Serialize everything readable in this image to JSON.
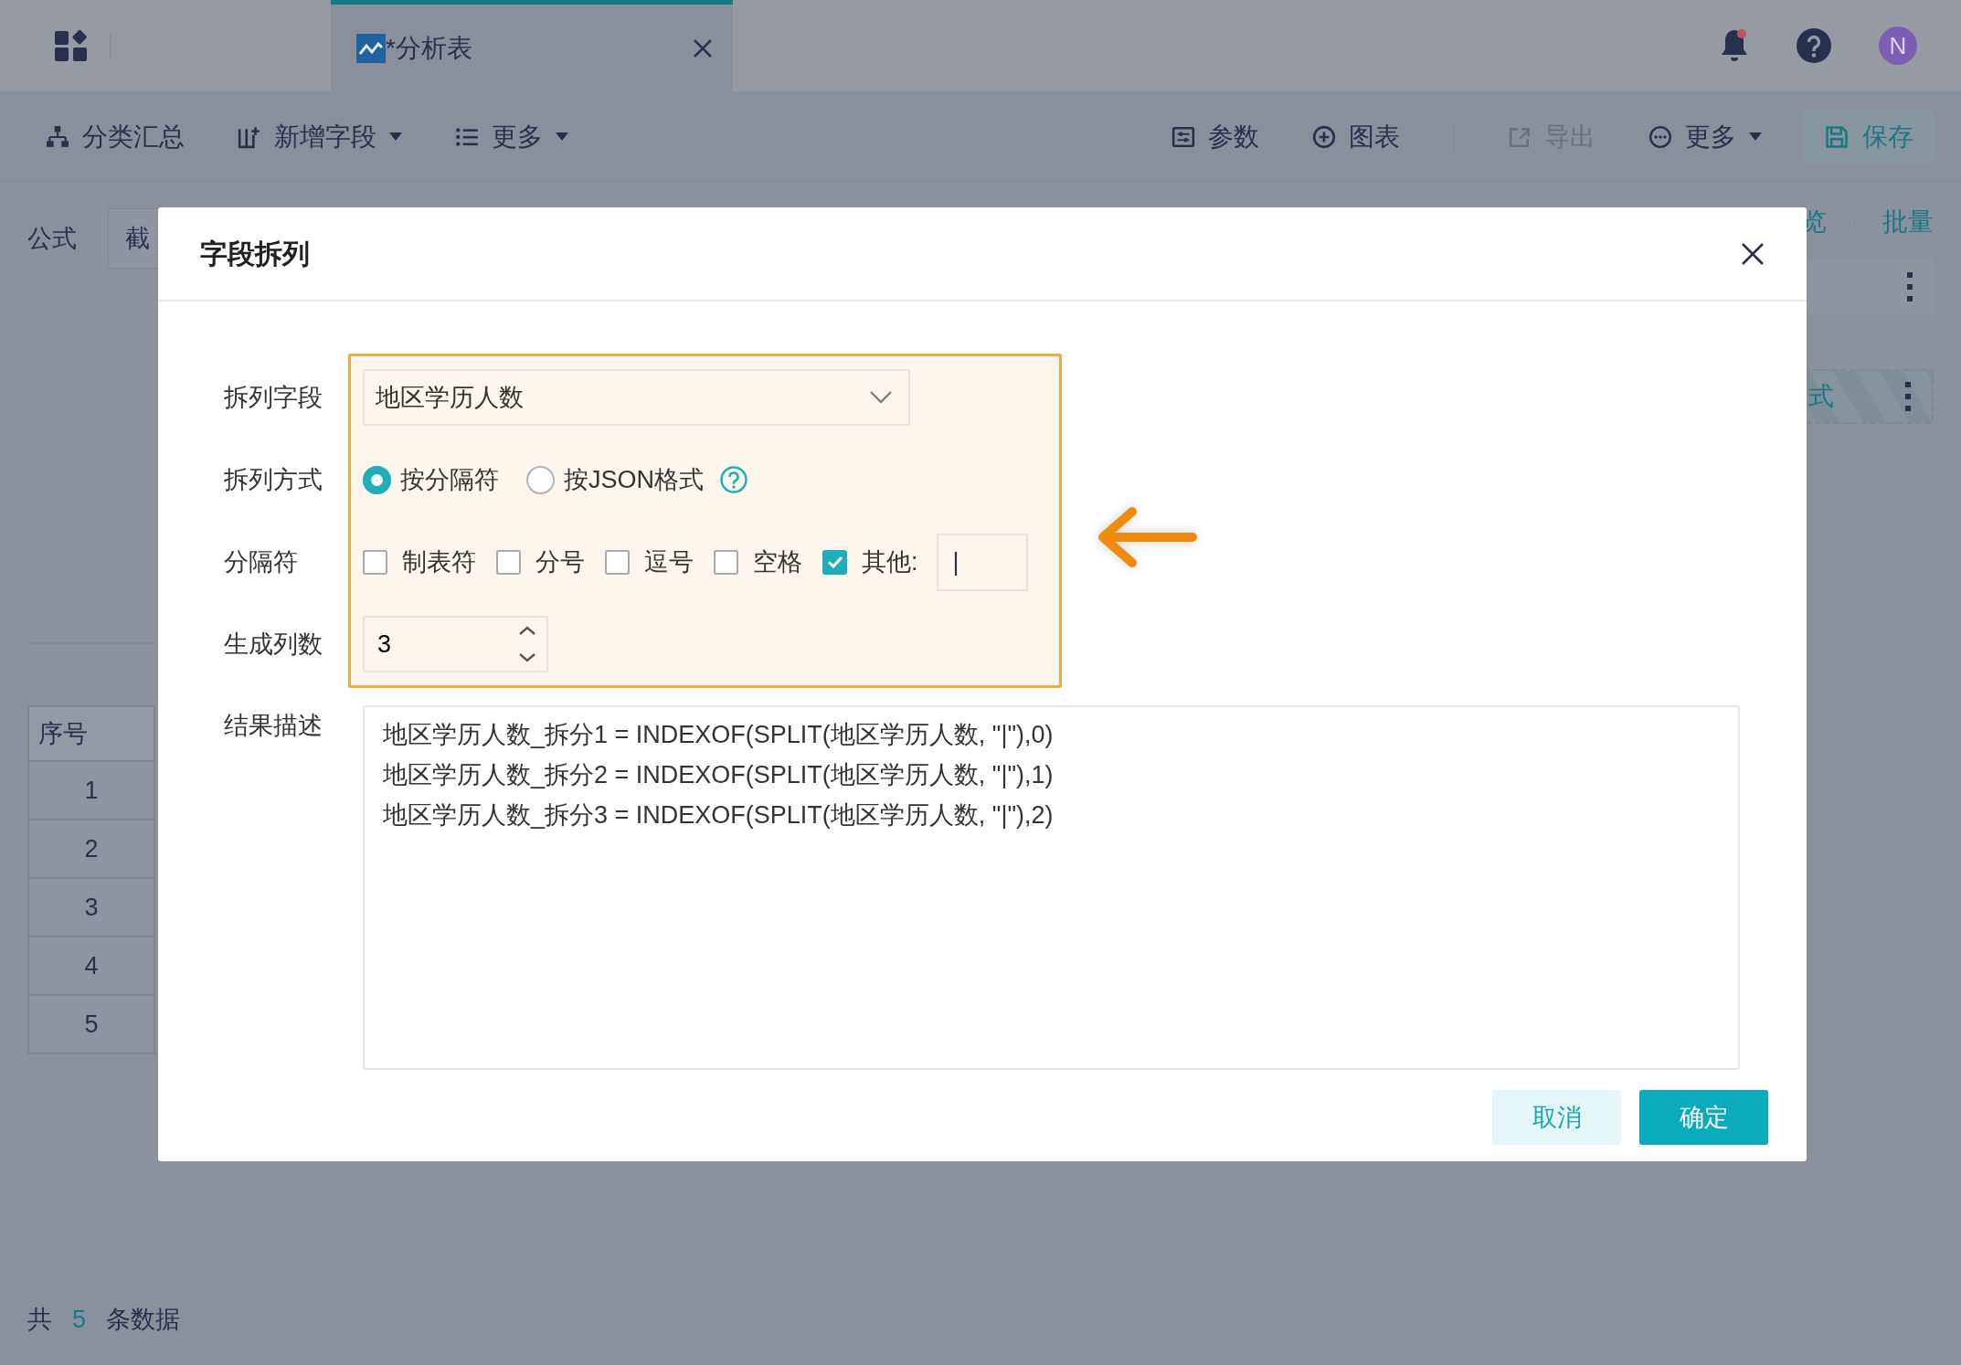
{
  "top_bar": {
    "tabs": [
      {
        "label": "*分析表",
        "selected": true
      }
    ],
    "notification": {
      "unread": true
    },
    "avatar": "N"
  },
  "toolbar": {
    "left": [
      {
        "label": "分类汇总",
        "dropdown": false
      },
      {
        "label": "新增字段",
        "dropdown": true
      },
      {
        "label": "更多",
        "dropdown": true
      }
    ],
    "right": [
      {
        "label": "参数",
        "dropdown": false,
        "disabled": false
      },
      {
        "label": "图表",
        "dropdown": false,
        "disabled": false
      },
      {
        "label": "导出",
        "dropdown": false,
        "disabled": true
      },
      {
        "label": "更多",
        "dropdown": true,
        "disabled": false
      }
    ],
    "save_button": {
      "label": "保存"
    }
  },
  "formula": {
    "label": "公式",
    "value": "截"
  },
  "side_panel": {
    "links": [
      "览",
      "批量"
    ],
    "cards": [
      {
        "kind": "solid"
      },
      {
        "kind": "dashed",
        "label": "式"
      }
    ]
  },
  "table": {
    "columns": [
      "序号"
    ],
    "rows": [
      [
        "1"
      ],
      [
        "2"
      ],
      [
        "3"
      ],
      [
        "4"
      ],
      [
        "5"
      ]
    ]
  },
  "footer": {
    "prefix": "共",
    "count": "5",
    "suffix": "条数据"
  },
  "dialog": {
    "title": "字段拆列",
    "split_field": {
      "label": "拆列字段",
      "value": "地区学历人数"
    },
    "split_method": {
      "label": "拆列方式",
      "options": [
        {
          "label": "按分隔符",
          "selected": true
        },
        {
          "label": "按JSON格式",
          "selected": false
        }
      ]
    },
    "separator": {
      "label": "分隔符",
      "options": [
        {
          "label": "制表符",
          "checked": false
        },
        {
          "label": "分号",
          "checked": false
        },
        {
          "label": "逗号",
          "checked": false
        },
        {
          "label": "空格",
          "checked": false
        },
        {
          "label": "其他:",
          "checked": true
        }
      ],
      "other_value": "|"
    },
    "column_count": {
      "label": "生成列数",
      "value": "3"
    },
    "result": {
      "label": "结果描述",
      "lines": [
        "地区学历人数_拆分1 = INDEXOF(SPLIT(地区学历人数, \"|\"),0)",
        "地区学历人数_拆分2 = INDEXOF(SPLIT(地区学历人数, \"|\"),1)",
        "地区学历人数_拆分3 = INDEXOF(SPLIT(地区学历人数, \"|\"),2)"
      ]
    },
    "buttons": [
      {
        "label": "取消",
        "kind": "secondary"
      },
      {
        "label": "确定",
        "kind": "primary"
      }
    ]
  }
}
